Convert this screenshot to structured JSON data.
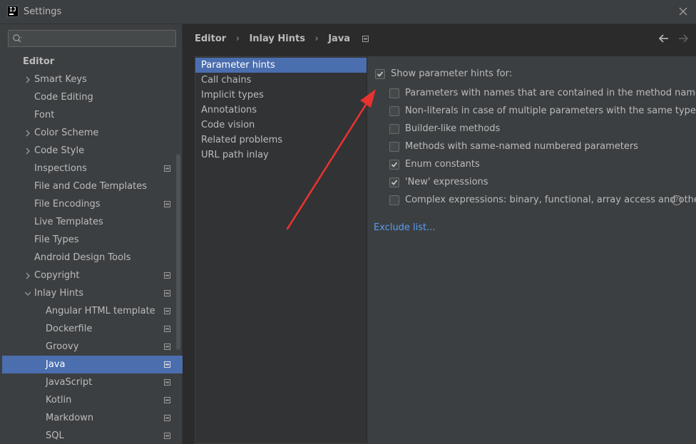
{
  "window": {
    "title": "Settings"
  },
  "search": {
    "placeholder": ""
  },
  "tree": {
    "items": [
      {
        "label": "Editor",
        "level": 0,
        "arrow": false,
        "bold": true,
        "proj": false
      },
      {
        "label": "Smart Keys",
        "level": 1,
        "arrow": true,
        "bold": false,
        "proj": false
      },
      {
        "label": "Code Editing",
        "level": 1,
        "arrow": false,
        "bold": false,
        "proj": false
      },
      {
        "label": "Font",
        "level": 1,
        "arrow": false,
        "bold": false,
        "proj": false
      },
      {
        "label": "Color Scheme",
        "level": 1,
        "arrow": true,
        "bold": false,
        "proj": false
      },
      {
        "label": "Code Style",
        "level": 1,
        "arrow": true,
        "bold": false,
        "proj": false
      },
      {
        "label": "Inspections",
        "level": 1,
        "arrow": false,
        "bold": false,
        "proj": true
      },
      {
        "label": "File and Code Templates",
        "level": 1,
        "arrow": false,
        "bold": false,
        "proj": false
      },
      {
        "label": "File Encodings",
        "level": 1,
        "arrow": false,
        "bold": false,
        "proj": true
      },
      {
        "label": "Live Templates",
        "level": 1,
        "arrow": false,
        "bold": false,
        "proj": false
      },
      {
        "label": "File Types",
        "level": 1,
        "arrow": false,
        "bold": false,
        "proj": false
      },
      {
        "label": "Android Design Tools",
        "level": 1,
        "arrow": false,
        "bold": false,
        "proj": false
      },
      {
        "label": "Copyright",
        "level": 1,
        "arrow": true,
        "bold": false,
        "proj": true
      },
      {
        "label": "Inlay Hints",
        "level": 1,
        "arrow": true,
        "expanded": true,
        "bold": false,
        "proj": true
      },
      {
        "label": "Angular HTML template",
        "level": 2,
        "arrow": false,
        "bold": false,
        "proj": true
      },
      {
        "label": "Dockerfile",
        "level": 2,
        "arrow": false,
        "bold": false,
        "proj": true
      },
      {
        "label": "Groovy",
        "level": 2,
        "arrow": false,
        "bold": false,
        "proj": true
      },
      {
        "label": "Java",
        "level": 2,
        "arrow": false,
        "bold": false,
        "proj": true,
        "selected": true
      },
      {
        "label": "JavaScript",
        "level": 2,
        "arrow": false,
        "bold": false,
        "proj": true
      },
      {
        "label": "Kotlin",
        "level": 2,
        "arrow": false,
        "bold": false,
        "proj": true
      },
      {
        "label": "Markdown",
        "level": 2,
        "arrow": false,
        "bold": false,
        "proj": true
      },
      {
        "label": "SQL",
        "level": 2,
        "arrow": false,
        "bold": false,
        "proj": true
      }
    ]
  },
  "breadcrumb": [
    "Editor",
    "Inlay Hints",
    "Java"
  ],
  "hints": {
    "items": [
      "Parameter hints",
      "Call chains",
      "Implicit types",
      "Annotations",
      "Code vision",
      "Related problems",
      "URL path inlay"
    ],
    "selected_index": 0
  },
  "options": {
    "main": {
      "label": "Show parameter hints for:",
      "checked": true
    },
    "items": [
      {
        "label": "Parameters with names that are contained in the method name",
        "checked": false
      },
      {
        "label": "Non-literals in case of multiple parameters with the same type",
        "checked": false
      },
      {
        "label": "Builder-like methods",
        "checked": false
      },
      {
        "label": "Methods with same-named numbered parameters",
        "checked": false
      },
      {
        "label": "Enum constants",
        "checked": true
      },
      {
        "label": "'New' expressions",
        "checked": true
      },
      {
        "label": "Complex expressions: binary, functional, array access and other",
        "checked": false,
        "help": true
      }
    ],
    "exclude_link": "Exclude list..."
  },
  "colors": {
    "selection": "#4b6eaf",
    "link": "#589df6",
    "annotation_arrow": "#e8322f"
  }
}
